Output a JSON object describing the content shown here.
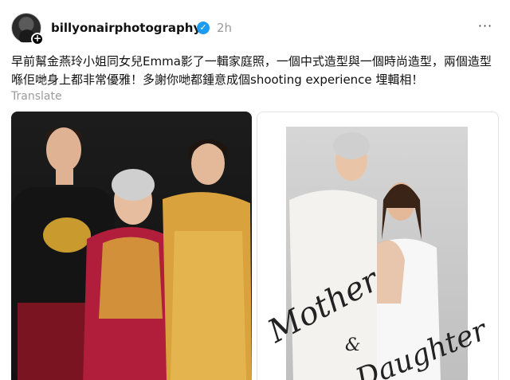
{
  "post": {
    "username": "billyonairphotography",
    "time": "2h",
    "more_label": "···",
    "caption": "早前幫金燕玲小姐同女兒Emma影了一輯家庭照，一個中式造型與一個時尚造型，兩個造型喺佢哋身上都非常優雅！多謝你哋都鍾意成個shooting experience 埋輯相！",
    "translate_label": "Translate"
  },
  "photos": {
    "right_script_1": "Mother",
    "right_script_2": "&",
    "right_script_3": "Daughter"
  },
  "colors": {
    "verified": "#1d9bf0",
    "secondary_text": "#9a9a9a"
  },
  "icons": {
    "verified": "verified-badge-icon",
    "more": "more-options-icon",
    "follow": "plus-icon"
  }
}
